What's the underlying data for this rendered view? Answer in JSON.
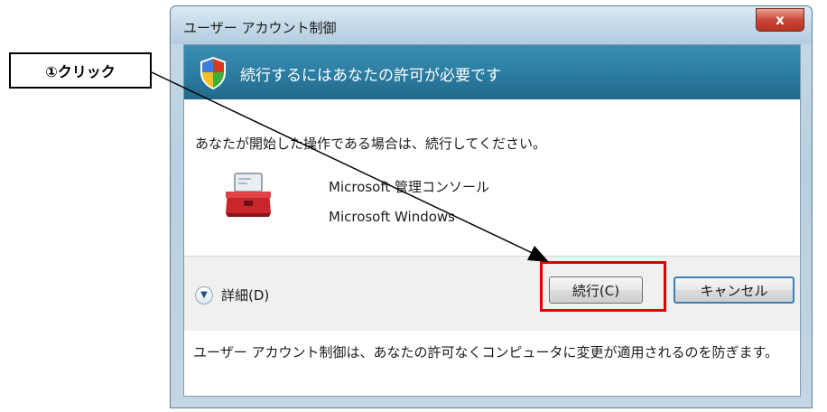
{
  "annotation": {
    "label": "①クリック"
  },
  "window": {
    "title": "ユーザー アカウント制御",
    "close_label": "x"
  },
  "banner": {
    "heading": "続行するにはあなたの許可が必要です"
  },
  "message": "あなたが開始した操作である場合は、続行してください。",
  "application": {
    "name": "Microsoft 管理コンソール",
    "publisher": "Microsoft Windows",
    "icon": "toolbox-icon"
  },
  "details": {
    "label": "詳細(D)",
    "icon": "chevron-down-icon"
  },
  "buttons": {
    "continue_label": "続行(C)",
    "cancel_label": "キャンセル"
  },
  "footer": {
    "text": "ユーザー アカウント制御は、あなたの許可なくコンピュータに変更が適用されるのを防ぎます。"
  },
  "colors": {
    "banner": "#2b7ca0",
    "highlight": "#e00000",
    "close": "#c9473a"
  }
}
